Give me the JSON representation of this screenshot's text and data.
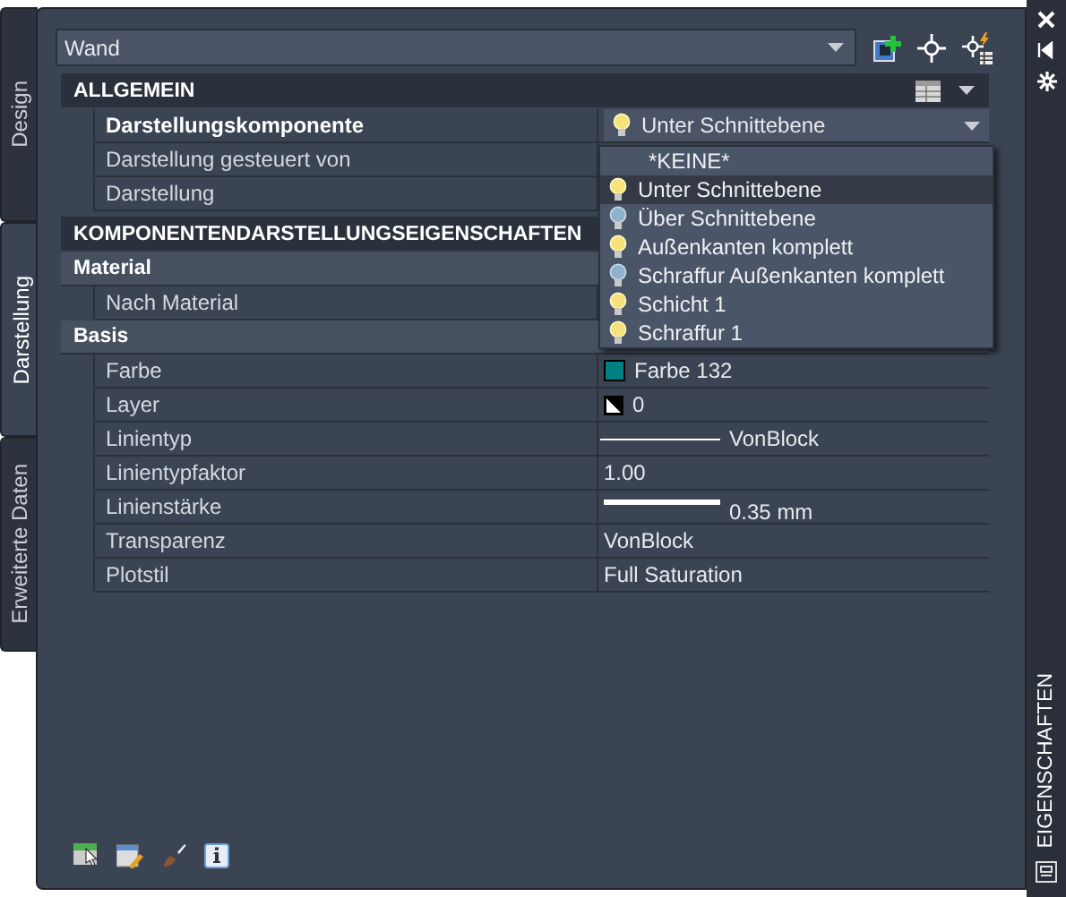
{
  "side_tabs": [
    {
      "label": "Design",
      "selected": false
    },
    {
      "label": "Darstellung",
      "selected": true
    },
    {
      "label": "Erweiterte Daten",
      "selected": false
    }
  ],
  "object_selector": {
    "value": "Wand"
  },
  "categories": [
    {
      "title": "ALLGEMEIN",
      "kind": "header",
      "rows": [
        {
          "label": "Darstellungskomponente",
          "bold": true,
          "kind": "dropdown",
          "value": "Unter Schnittebene",
          "lit": true
        },
        {
          "label": "Darstellung gesteuert von",
          "bold": false,
          "kind": "text"
        },
        {
          "label": "Darstellung",
          "bold": false,
          "kind": "text"
        }
      ]
    },
    {
      "title": "KOMPONENTENDARSTELLUNGSEIGENSCHAFTEN",
      "kind": "header"
    },
    {
      "title": "Material",
      "kind": "sub",
      "rows": [
        {
          "label": "Nach Material",
          "bold": false,
          "kind": "text"
        }
      ]
    },
    {
      "title": "Basis",
      "kind": "sub",
      "rows": [
        {
          "label": "Farbe",
          "bold": false,
          "kind": "color",
          "value": "Farbe 132",
          "color": "#008080"
        },
        {
          "label": "Layer",
          "bold": false,
          "kind": "layer",
          "value": "0"
        },
        {
          "label": "Linientyp",
          "bold": false,
          "kind": "linetype",
          "value": "VonBlock"
        },
        {
          "label": "Linientypfaktor",
          "bold": false,
          "kind": "text",
          "value": "1.00"
        },
        {
          "label": "Linienstärke",
          "bold": false,
          "kind": "lineweight",
          "value": "0.35 mm"
        },
        {
          "label": "Transparenz",
          "bold": false,
          "kind": "text",
          "value": "VonBlock"
        },
        {
          "label": "Plotstil",
          "bold": false,
          "kind": "text",
          "value": "Full Saturation"
        }
      ]
    }
  ],
  "dropdown_list": [
    {
      "label": "*KEINE*",
      "selected": false
    },
    {
      "label": "Unter Schnittebene",
      "selected": true,
      "lit": true
    },
    {
      "label": "Über Schnittebene",
      "selected": false,
      "lit": false
    },
    {
      "label": "Außenkanten komplett",
      "selected": false,
      "lit": true
    },
    {
      "label": "Schraffur Außenkanten komplett",
      "selected": false,
      "lit": false
    },
    {
      "label": "Schicht 1",
      "selected": false,
      "lit": true
    },
    {
      "label": "Schraffur 1",
      "selected": false,
      "lit": true
    }
  ],
  "palette_title": "EIGENSCHAFTEN"
}
